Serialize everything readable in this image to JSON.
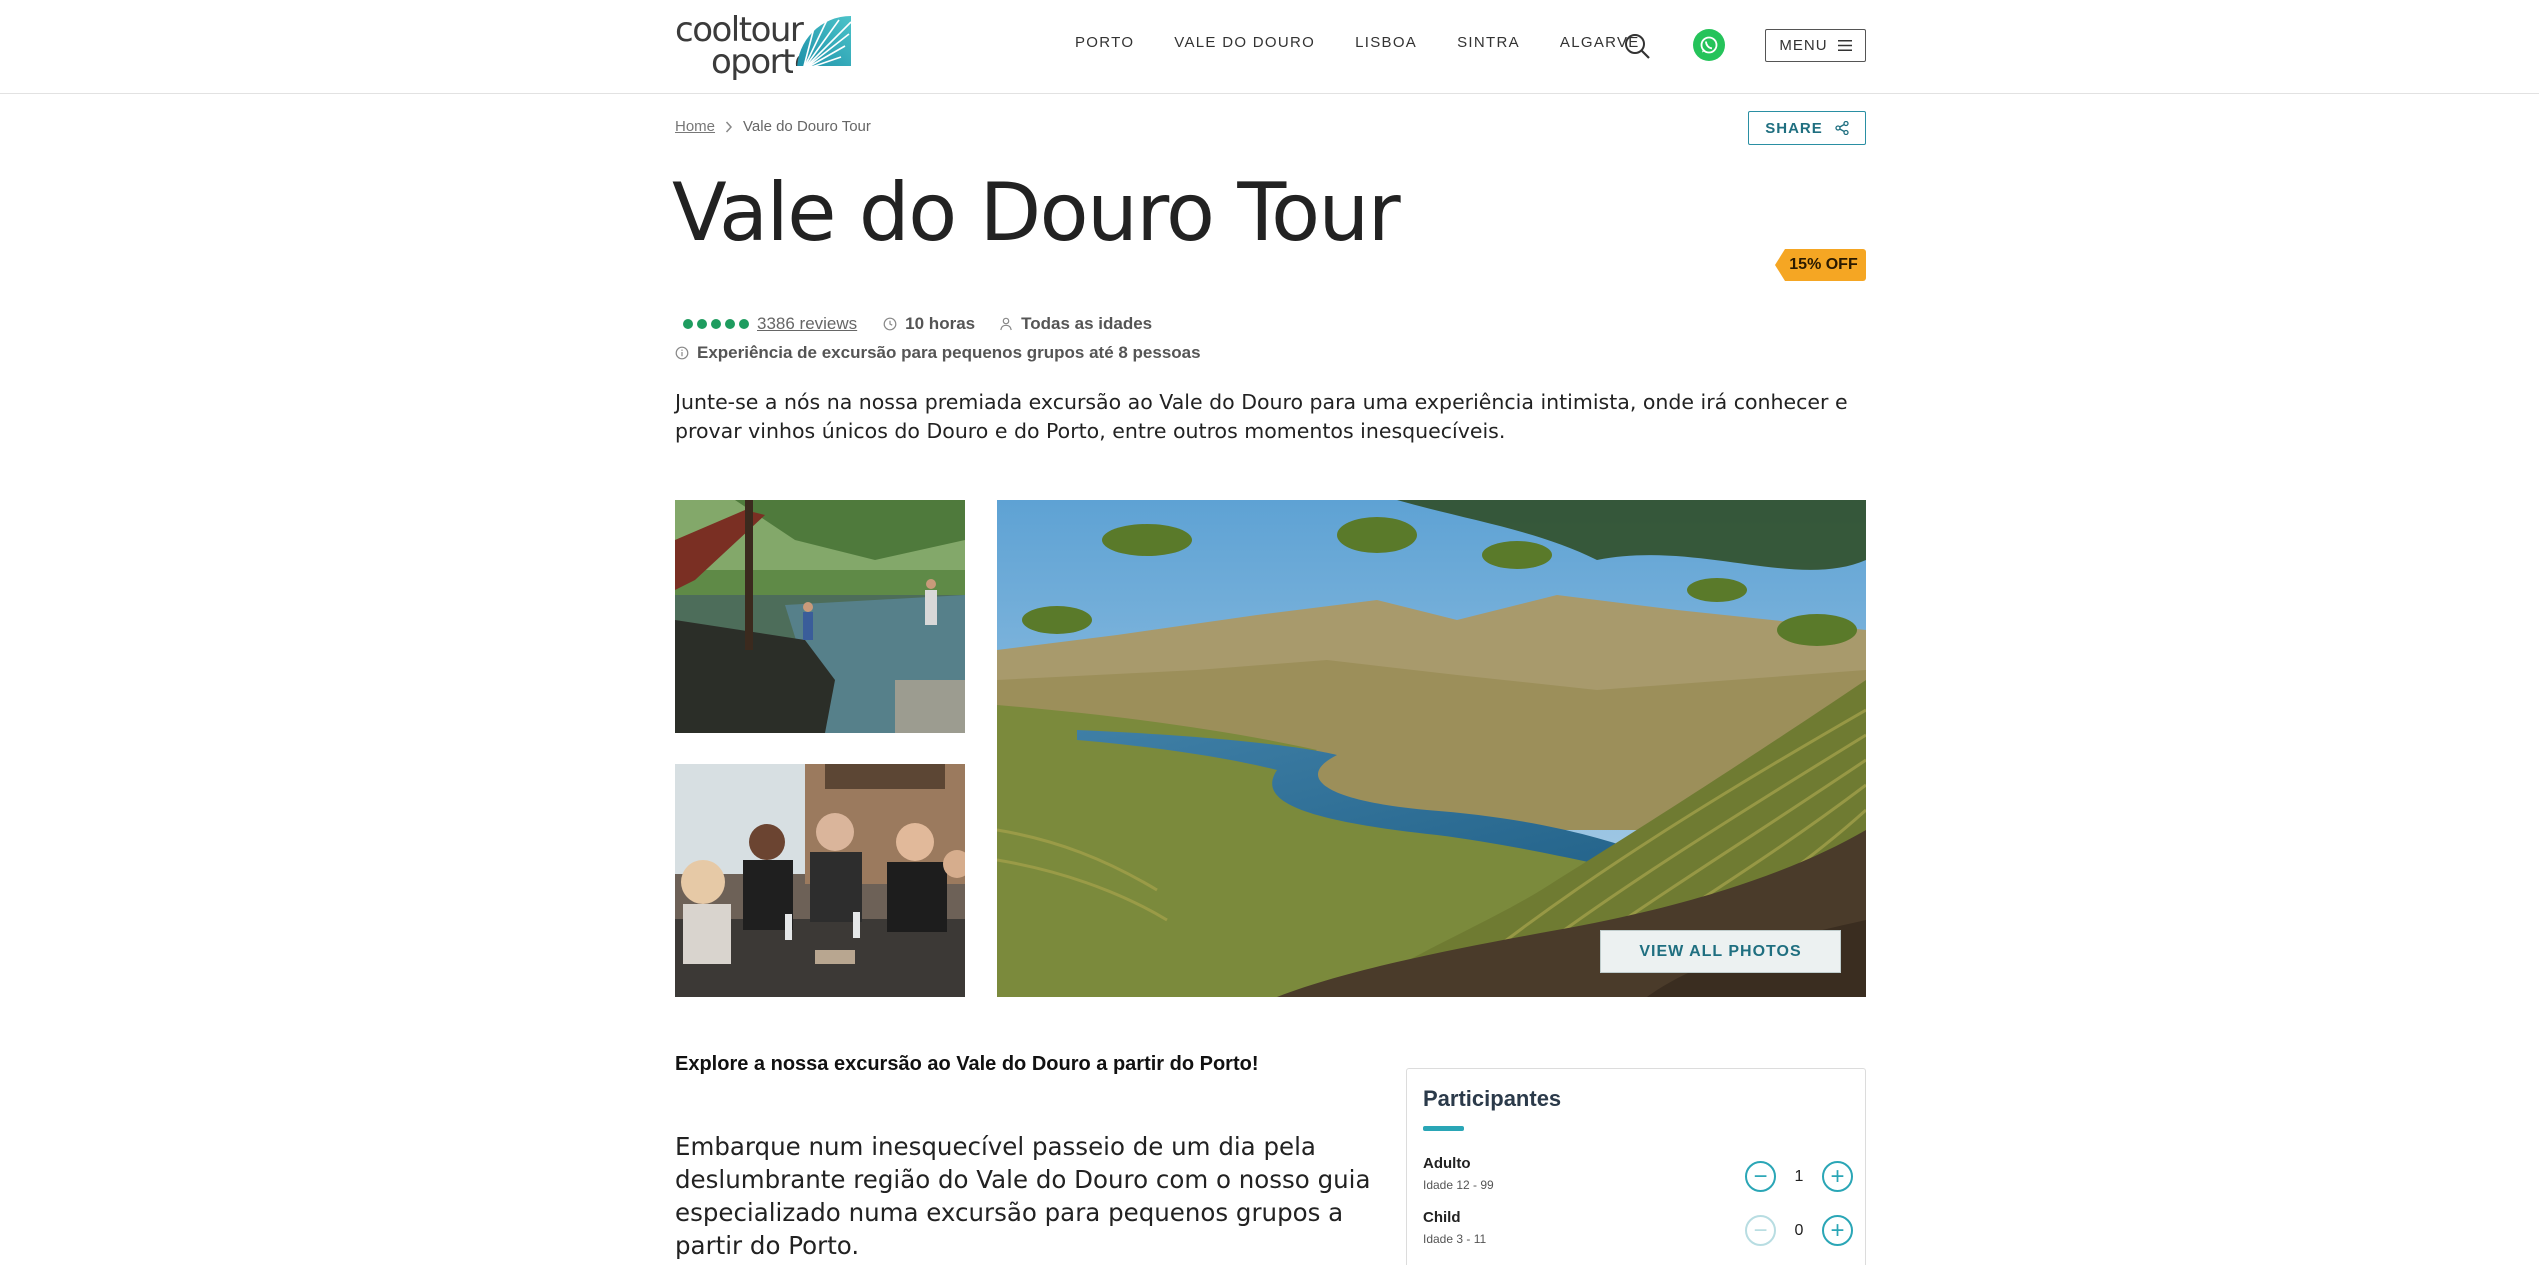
{
  "logo": {
    "line1": "cooltour",
    "line2": "oporto"
  },
  "nav": {
    "items": [
      "PORTO",
      "VALE DO DOURO",
      "LISBOA",
      "SINTRA",
      "ALGARVE"
    ],
    "menu_label": "MENU"
  },
  "icons": {
    "search": "search-icon",
    "whatsapp": "whatsapp-icon",
    "menu": "hamburger-icon",
    "share": "share-icon",
    "clock": "clock-icon",
    "person": "person-icon",
    "info": "info-icon"
  },
  "colors": {
    "accent": "#2aa6b6",
    "share_text": "#1f6f80",
    "badge": "#f5a623",
    "whatsapp": "#25c35a",
    "rating": "#1e9c5f"
  },
  "breadcrumb": {
    "home": "Home",
    "current": "Vale do Douro Tour"
  },
  "share_label": "SHARE",
  "title": "Vale do Douro Tour",
  "badge": "15% OFF",
  "meta": {
    "rating_dots": 5,
    "reviews": "3386 reviews",
    "duration": "10 horas",
    "ages": "Todas as idades",
    "group": "Experiência de excursão para pequenos grupos até 8 pessoas"
  },
  "intro": "Junte-se a nós na nossa premiada excursão ao Vale do Douro para uma experiência intimista, onde irá conhecer e provar vinhos únicos do Douro e do Porto, entre outros momentos inesquecíveis.",
  "view_all_photos": "VIEW ALL PHOTOS",
  "explore_heading": "Explore a nossa excursão ao Vale do Douro a partir do Porto!",
  "body_text": "Embarque num inesquecível passeio de um dia pela deslumbrante região do Vale do Douro com o nosso guia especializado numa excursão para pequenos grupos a partir do Porto.",
  "booking": {
    "title": "Participantes",
    "rows": [
      {
        "label": "Adulto",
        "sub": "Idade 12 - 99",
        "value": "1"
      },
      {
        "label": "Child",
        "sub": "Idade 3 - 11",
        "value": "0"
      }
    ]
  }
}
